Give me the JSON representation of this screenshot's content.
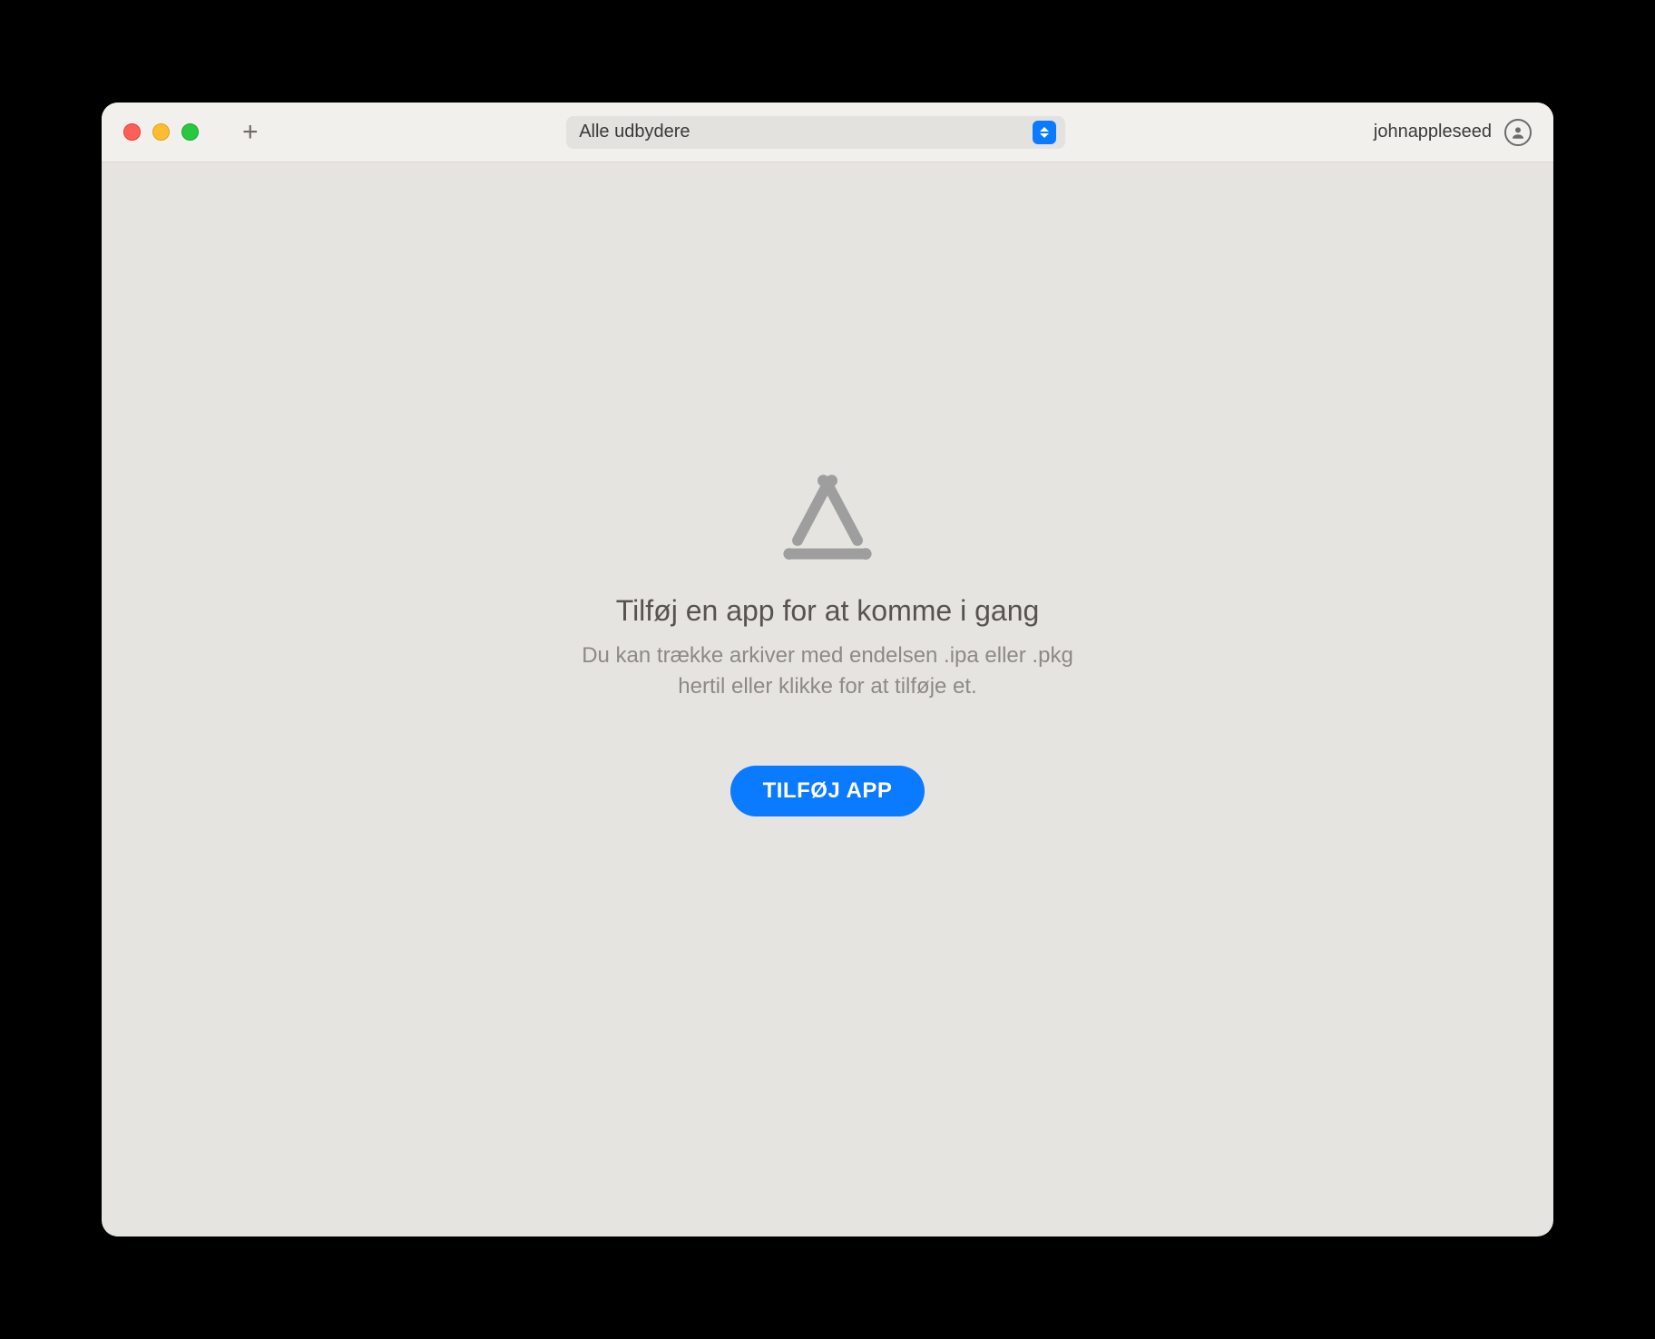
{
  "toolbar": {
    "providers_selected": "Alle udbydere",
    "username": "johnappleseed"
  },
  "empty_state": {
    "title": "Tilføj en app for at komme i gang",
    "description": "Du kan trække arkiver med endelsen .ipa eller .pkg hertil eller klikke for at tilføje et.",
    "cta_label": "TILFØJ APP"
  }
}
